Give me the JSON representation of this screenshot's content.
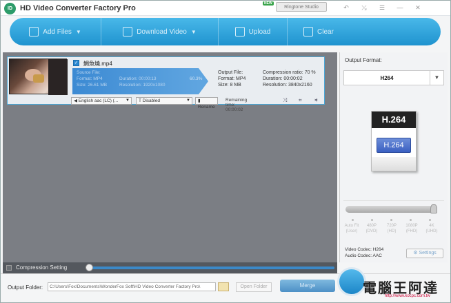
{
  "window": {
    "title": "HD Video Converter Factory Pro",
    "logo_text": "ID",
    "new_badge": "NEW",
    "studio_button": "Ringtone Studio",
    "controls": [
      "↶",
      "⤯",
      "☰",
      "—",
      "✕"
    ]
  },
  "toolbar": {
    "add_files": "Add Files",
    "download_video": "Download Video",
    "upload": "Upload",
    "clear": "Clear",
    "accent": "#2a9ad6"
  },
  "task": {
    "checked": true,
    "filename": "鯛魚燒.mp4",
    "source": {
      "label": "Source File:",
      "format": "Format: MP4",
      "duration": "Duration: 00:00:13",
      "size": "Size: 26.61 MB",
      "resolution": "Resolution: 1920x1080",
      "progress_text": "60.3%",
      "progress": 0.603
    },
    "output": {
      "label": "Output File:",
      "format": "Format: MP4",
      "size": "Size: 8 MB",
      "compression": "Compression ratio: 70 %",
      "duration": "Duration: 00:00:02",
      "resolution": "Resolution: 3840x2160"
    },
    "audio_track": "English aac (LC) (...",
    "subtitle": "Disabled",
    "rename": "Rename",
    "remaining": "Remaining time: 00:00:02",
    "icons": [
      "merge-icon",
      "crop-icon",
      "effects-icon"
    ]
  },
  "right_panel": {
    "output_format_label": "Output Format:",
    "format_value": "H264",
    "card_top": "H.264",
    "card_tile": "H.264",
    "quality_levels": [
      [
        "Auto Fit",
        "(User)"
      ],
      [
        "480P",
        "(DVD)"
      ],
      [
        "720P",
        "(HD)"
      ],
      [
        "1080P",
        "(FHD)"
      ],
      [
        "4K",
        "(UHD)"
      ]
    ],
    "video_codec": "Video Codec: H264",
    "audio_codec": "Audio Codec: AAC",
    "settings": "Settings"
  },
  "compression": {
    "label": "Compression Setting"
  },
  "bottom": {
    "output_folder_label": "Output Folder:",
    "output_path": "C:\\Users\\Fox\\Documents\\WonderFox Soft\\HD Video Converter Factory Pro\\",
    "open_folder": "Open Folder",
    "merge": "Merge",
    "watermark": "電腦王阿達",
    "watermark_url": "http://www.kocpc.com.tw"
  }
}
